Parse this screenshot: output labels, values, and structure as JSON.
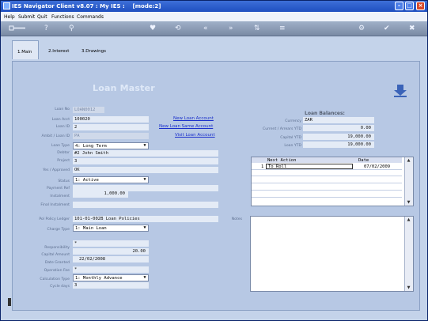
{
  "window": {
    "title": "IES Navigator Client v8.07 : My IES :",
    "mode": "[mode:2]"
  },
  "menu": [
    "Help",
    "Submit",
    "Quit",
    "Functions",
    "Commands"
  ],
  "tabs": [
    {
      "label": "1.Main"
    },
    {
      "label": "2.Interest"
    },
    {
      "label": "3.Drawings"
    }
  ],
  "page": {
    "heading": "Loan Master"
  },
  "links": {
    "new_loan": "New Loan Account",
    "new_loan_same": "New Loan Same Account",
    "visit_loan": "Visit Loan Account"
  },
  "form": {
    "loan_no": {
      "label": "Loan No",
      "value": "LOAN0012"
    },
    "loan_acct": {
      "label": "Loan Acct",
      "value": "100020"
    },
    "loan_id": {
      "label": "Loan ID",
      "value": "2"
    },
    "ambit": {
      "label": "Ambit / Loan ID",
      "value": "PA"
    },
    "loan_type": {
      "label": "Loan Type",
      "value": "4: Long Term"
    },
    "debtor": {
      "label": "Debtor",
      "value": "#2 John Smith"
    },
    "project": {
      "label": "Project",
      "value": "3"
    },
    "approved": {
      "label": "Yes / Approved",
      "value": "OK"
    },
    "status": {
      "label": "Status",
      "value": "1: Active"
    },
    "payment_ref": {
      "label": "Payment Ref",
      "value": ""
    },
    "instalment": {
      "label": "Instalment",
      "value": "1,000.00"
    },
    "final_instalment": {
      "label": "Final Instalment",
      "value": ""
    },
    "pol_ledger": {
      "label": "Pol Policy Ledger",
      "value": "101-01-002B Loan Policies"
    },
    "charge_type": {
      "label": "Charge Type",
      "value": "1: Main Loan"
    },
    "responsibility": {
      "label": "Responsibility",
      "value": "*"
    },
    "capital_amount": {
      "label": "Capital Amount",
      "value": "20.00"
    },
    "date_granted": {
      "label": "Date Granted",
      "value": "22/02/2008"
    },
    "operation_fee": {
      "label": "Operation Fee",
      "value": "*"
    },
    "calculation_type": {
      "label": "Calculation Type",
      "value": "1: Monthly Advance"
    },
    "cycle_days": {
      "label": "Cycle days",
      "value": "3"
    }
  },
  "balances": {
    "heading": "Loan Balances:",
    "currency": {
      "label": "Currency",
      "value": "ZAR"
    },
    "current_arrears": {
      "label": "Current / Arrears YTD",
      "value": "0.00"
    },
    "capital_ytd": {
      "label": "Capital YTD",
      "value": "19,000.00"
    },
    "loan_ytd": {
      "label": "Loan YTD",
      "value": "19,000.00"
    }
  },
  "actions": {
    "columns": [
      "Next Action",
      "Date"
    ],
    "rows": [
      {
        "index": "1",
        "action": "To Roll",
        "date": "07/02/2009"
      }
    ]
  },
  "notes": {
    "label": "Notes"
  }
}
